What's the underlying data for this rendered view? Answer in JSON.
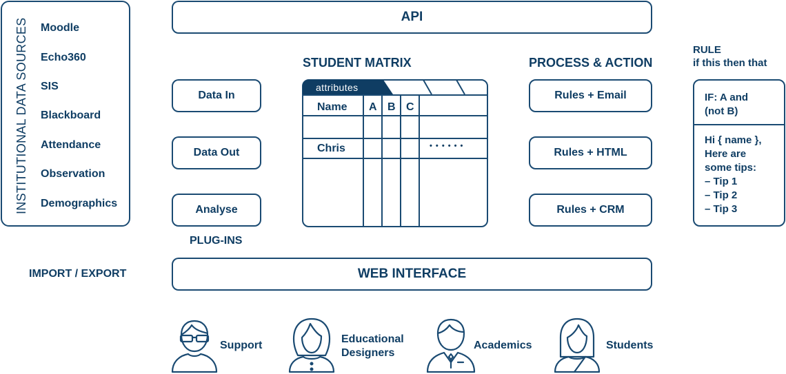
{
  "colors": {
    "primary": "#0f3d63",
    "stroke": "#1a4a72",
    "background": "#ffffff"
  },
  "sources": {
    "title": "INSTITUTIONAL DATA SOURCES",
    "items": [
      "Moodle",
      "Echo360",
      "SIS",
      "Blackboard",
      "Attendance",
      "Observation",
      "Demographics"
    ]
  },
  "api": {
    "label": "API"
  },
  "plugins": {
    "items": [
      "Data In",
      "Data Out",
      "Analyse"
    ],
    "caption": "PLUG-INS"
  },
  "matrix": {
    "title": "STUDENT MATRIX",
    "active_tab": "attributes",
    "columns": [
      "Name",
      "A",
      "B",
      "C",
      ""
    ],
    "rows": [
      [
        "",
        "",
        "",
        "",
        ""
      ],
      [
        "Chris",
        "",
        "",
        "",
        "• • • • • •"
      ],
      [
        "",
        "",
        "",
        "",
        ""
      ]
    ]
  },
  "process": {
    "title": "PROCESS & ACTION",
    "items": [
      "Rules + Email",
      "Rules + HTML",
      "Rules + CRM"
    ]
  },
  "rule": {
    "title": "RULE",
    "subtitle": "if this then that",
    "condition_lines": [
      "IF: A and",
      "(not B)"
    ],
    "body_lines": [
      "Hi { name },",
      "Here are",
      "some tips:",
      "– Tip 1",
      "– Tip 2",
      "– Tip 3"
    ]
  },
  "import_export": {
    "label": "IMPORT / EXPORT"
  },
  "web_interface": {
    "label": "WEB INTERFACE"
  },
  "users": [
    {
      "label_lines": [
        "Support"
      ],
      "icon": "support-person-icon"
    },
    {
      "label_lines": [
        "Educational",
        "Designers"
      ],
      "icon": "designer-person-icon"
    },
    {
      "label_lines": [
        "Academics"
      ],
      "icon": "academic-person-icon"
    },
    {
      "label_lines": [
        "Students"
      ],
      "icon": "student-person-icon"
    }
  ]
}
